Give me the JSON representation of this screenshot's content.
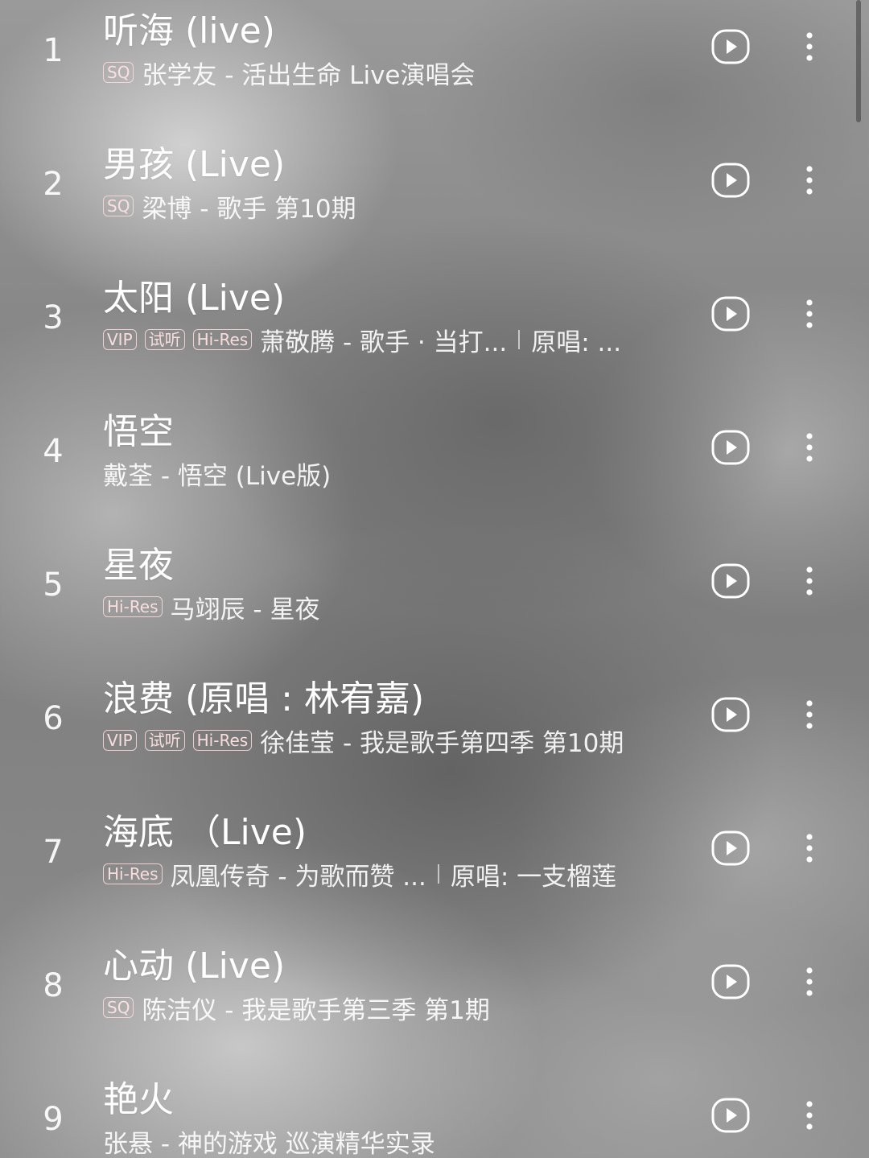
{
  "songs": [
    {
      "rank": "1",
      "title": "听海 (live)",
      "badges": [
        "SQ"
      ],
      "subtitle": "张学友 - 活出生命 Live演唱会",
      "extra": ""
    },
    {
      "rank": "2",
      "title": "男孩 (Live)",
      "badges": [
        "SQ"
      ],
      "subtitle": "梁博 - 歌手 第10期",
      "extra": ""
    },
    {
      "rank": "3",
      "title": "太阳 (Live)",
      "badges": [
        "VIP",
        "试听",
        "Hi-Res"
      ],
      "subtitle": "萧敬腾 - 歌手 · 当打...",
      "extra": "原唱: ..."
    },
    {
      "rank": "4",
      "title": "悟空",
      "badges": [],
      "subtitle": "戴荃 - 悟空 (Live版)",
      "extra": ""
    },
    {
      "rank": "5",
      "title": "星夜",
      "badges": [
        "Hi-Res"
      ],
      "subtitle": "马翊辰 - 星夜",
      "extra": ""
    },
    {
      "rank": "6",
      "title": "浪费 (原唱 : 林宥嘉)",
      "badges": [
        "VIP",
        "试听",
        "Hi-Res"
      ],
      "subtitle": "徐佳莹 - 我是歌手第四季 第10期",
      "extra": ""
    },
    {
      "rank": "7",
      "title": "海底 （Live)",
      "badges": [
        "Hi-Res"
      ],
      "subtitle": "凤凰传奇 - 为歌而赞 ...",
      "extra": "原唱: 一支榴莲"
    },
    {
      "rank": "8",
      "title": "心动 (Live)",
      "badges": [
        "SQ"
      ],
      "subtitle": "陈洁仪 - 我是歌手第三季 第1期",
      "extra": ""
    },
    {
      "rank": "9",
      "title": "艳火",
      "badges": [],
      "subtitle": "张悬 - 神的游戏 巡演精华实录",
      "extra": ""
    }
  ],
  "icons": {
    "play": "play-circle-icon",
    "more": "more-vertical-icon"
  },
  "colors": {
    "text": "#ffffff",
    "badge_border": "#ffdcdc"
  }
}
